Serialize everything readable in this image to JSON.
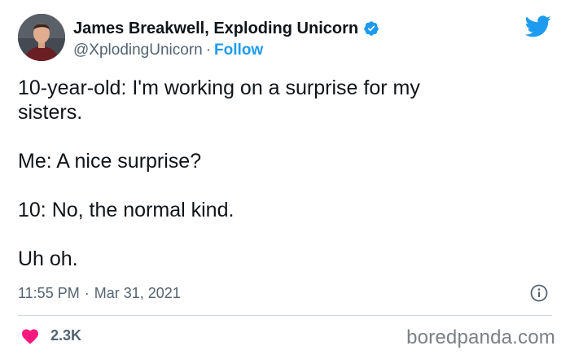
{
  "author": {
    "display_name": "James Breakwell, Exploding Unicorn",
    "handle": "@XplodingUnicorn",
    "separator": "·",
    "follow_label": "Follow",
    "verified": true
  },
  "tweet": {
    "text": "10-year-old: I'm working on a surprise for my\nsisters.\n\nMe: A nice surprise?\n\n10: No, the normal kind.\n\nUh oh.",
    "time": "11:55 PM",
    "meta_separator": "·",
    "date": "Mar 31, 2021"
  },
  "engagement": {
    "likes": "2.3K"
  },
  "watermark": "boredpanda.com",
  "icons": [
    "twitter-bird-icon",
    "verified-badge-icon",
    "info-icon",
    "heart-icon"
  ],
  "colors": {
    "accent": "#1d9bf0",
    "heart": "#f91880",
    "text": "#0f1419",
    "muted": "#536471",
    "divider": "#cfd9de"
  }
}
